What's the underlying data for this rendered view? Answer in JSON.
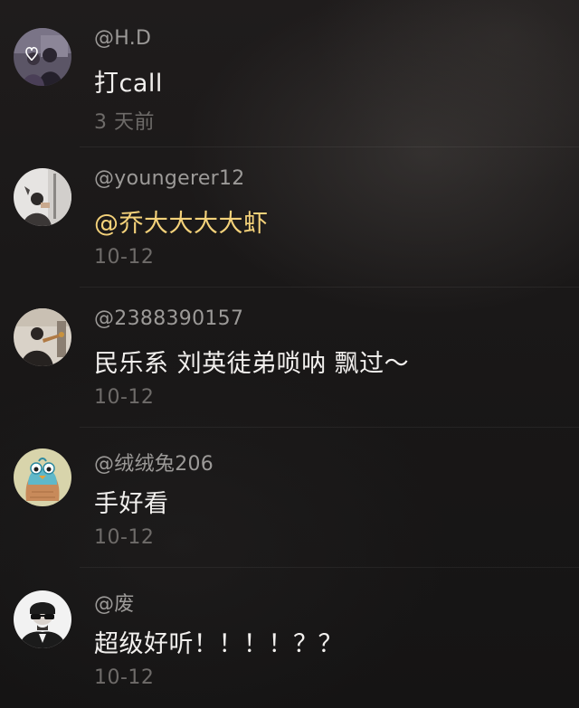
{
  "comments": [
    {
      "username": "@H.D",
      "text": "打call",
      "time": "3 天前",
      "mention": false,
      "avatar_icon": "couple-photo"
    },
    {
      "username": "@youngerer12",
      "text": "@乔大大大大虾",
      "time": "10-12",
      "mention": true,
      "avatar_icon": "person-photo"
    },
    {
      "username": "@2388390157",
      "text": "民乐系 刘英徒弟唢呐 飘过～",
      "time": "10-12",
      "mention": false,
      "avatar_icon": "musician-photo"
    },
    {
      "username": "@绒绒兔206",
      "text": "手好看",
      "time": "10-12",
      "mention": false,
      "avatar_icon": "cartoon-bird"
    },
    {
      "username": "@废",
      "text": "超级好听！！！！？？",
      "time": "10-12",
      "mention": false,
      "avatar_icon": "sunglasses-man"
    }
  ],
  "colors": {
    "username": "#9c9a98",
    "text": "#f2f0ee",
    "mention": "#f4d27a",
    "time": "#6e6b69"
  }
}
